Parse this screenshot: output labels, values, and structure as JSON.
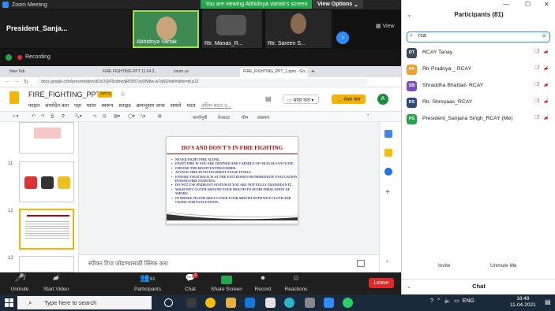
{
  "zoom": {
    "window_title": "Zoom Meeting",
    "viewing_banner": "You are viewing Abhidnya Vartak's screen",
    "view_options": "View Options",
    "view_label": "View",
    "participants_tiles": [
      {
        "name": "President_Sanja..."
      },
      {
        "name": "Abhidnya Vartak"
      },
      {
        "name": "Rtr. Manas_R..."
      },
      {
        "name": "Rtr. Sareen S..."
      }
    ],
    "recording_label": "Recording",
    "bottom_bar": {
      "unmute": "Unmute",
      "start_video": "Start Video",
      "participants": "Participants",
      "participants_count": "81",
      "chat": "Chat",
      "chat_badge": "2",
      "share_screen": "Share Screen",
      "record": "Record",
      "reactions": "Reactions",
      "leave": "Leave"
    }
  },
  "browser": {
    "tabs": [
      {
        "label": "New Tab"
      },
      {
        "label": "FIRE FIGHTING PPT 11.04.2..."
      },
      {
        "label": "zoom.us"
      },
      {
        "label": "FIRE_FIGHTING_PPT_1.pptx - Go..."
      }
    ],
    "url": "docs.google.com/presentation/d/1sOQiF9zdbwdjRD057zyDNlbw-w7qN2/edit#slide=id.p12"
  },
  "slides_app": {
    "doc_title": "FIRE_FIGHTING_PPT...1",
    "file_badge": ".PPTX",
    "menu": [
      "फाइल",
      "संपादित करा",
      "पहा",
      "घाला",
      "स्वरूप",
      "स्लाइड",
      "क्रमानुसार लावा",
      "साधने",
      "मदत"
    ],
    "last_edit_hint": "अंतिम बदल उ...",
    "present_label": "सादर करा",
    "share_label": "शेअर करा",
    "avatar_letter": "A",
    "toolbar": [
      "पार्श्वभूमी",
      "लेआउट",
      "थीम",
      "संक्रमण"
    ],
    "thumb_numbers": [
      "11",
      "12",
      "13"
    ],
    "notes_placeholder": "स्पीकर टिपा जोडण्यासाठी क्लिक करा",
    "slide": {
      "title": "DO'S AND DON'T'S IN FIRE FIGHTING",
      "bullets": [
        "NEVER FIGHT FIRE ALONE.",
        "FIGHT FIRE IF YOU ARE TRAINED AND CAPABLE OF OR ELSE EVACUATE.",
        "CHOOSE THE RIGHT EXTINGUISHER.",
        "ATTACK FIRE IN ITS INCIPIENT STAGE ITSELF.",
        "ENSURE YOUR BACK IS AT THE EXIT DOOR FOR IMMEDIATE EVACUATION DURING FIRE FIGHTING.",
        "DO NOT USE HYDRANT SYSTEM IF YOU ARE NOT FULLY TRAINED IN IT.",
        "WRAP WET CLOTH AROUND YOUR MOUTH TO AVOID INHALATION OF SMOKE.",
        "IN SMOKE FILLED AREA COVER YOUR MOUTH WITH WET CLOTH AND CRAWL FOR EVACUATION."
      ]
    }
  },
  "participants_panel": {
    "title": "Participants (81)",
    "search_value": "rca",
    "list": [
      {
        "initials": "RT",
        "name": "RCAY Tanay",
        "color": "#3c4a5a"
      },
      {
        "initials": "RP",
        "name": "Rtr Pradnya _ RCAY",
        "color": "#f0a12b"
      },
      {
        "initials": "SB",
        "name": "Shraddha Bhattad- RCAY",
        "color": "#7a4fc4"
      },
      {
        "initials": "RS",
        "name": "Rtr. Shreyaas_RCAY",
        "color": "#2d4a7a"
      },
      {
        "initials": "PS",
        "name": "President_Sanjana Singh_RCAY (Me)",
        "color": "#26a64a"
      }
    ],
    "invite": "Invite",
    "unmute_me": "Unmute Me",
    "chat_header": "Chat"
  },
  "taskbar": {
    "search_placeholder": "Type here to search",
    "language": "ENG",
    "time": "18:48",
    "date": "11-04-2021"
  }
}
